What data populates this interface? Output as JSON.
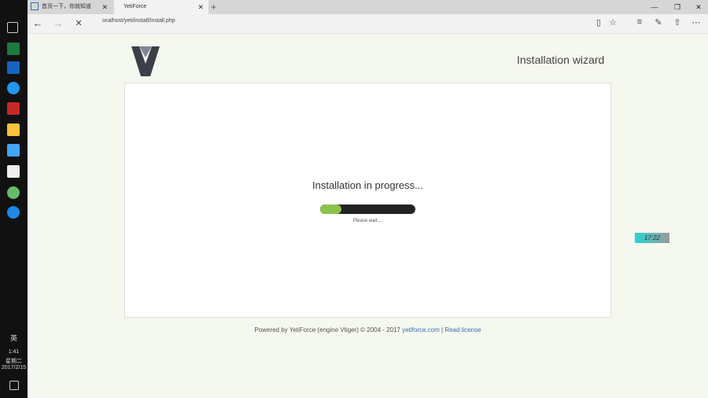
{
  "taskbar": {
    "ime_char": "英",
    "time": "1:41",
    "weekday": "星期二",
    "date": "2017/2/15"
  },
  "browser": {
    "tabs": [
      {
        "label": "首页一下，你就知道",
        "active": false
      },
      {
        "label": "YetiForce",
        "active": true
      }
    ],
    "new_tab": "+",
    "window_controls": {
      "minimize": "—",
      "restore": "❐",
      "close": "✕"
    },
    "nav": {
      "back": "←",
      "forward": "→",
      "stop": "✕"
    },
    "address": "ocalhost/yeti/install/Install.php"
  },
  "page": {
    "wizard_title": "Installation wizard",
    "progress_title": "Installation in progress...",
    "progress_value": 0.22,
    "please_wait": "Please wait....",
    "footer": {
      "powered": "Powered by YetiForce (engine Vtiger)  © 2004 - 2017",
      "link1": "yetiforce.com",
      "sep": "|",
      "link2": "Read license"
    }
  },
  "overlay": {
    "clock": "17:22"
  },
  "colors": {
    "accent": "#8bc34a",
    "page_bg": "#f4f8ee",
    "link": "#3a6fb0"
  }
}
